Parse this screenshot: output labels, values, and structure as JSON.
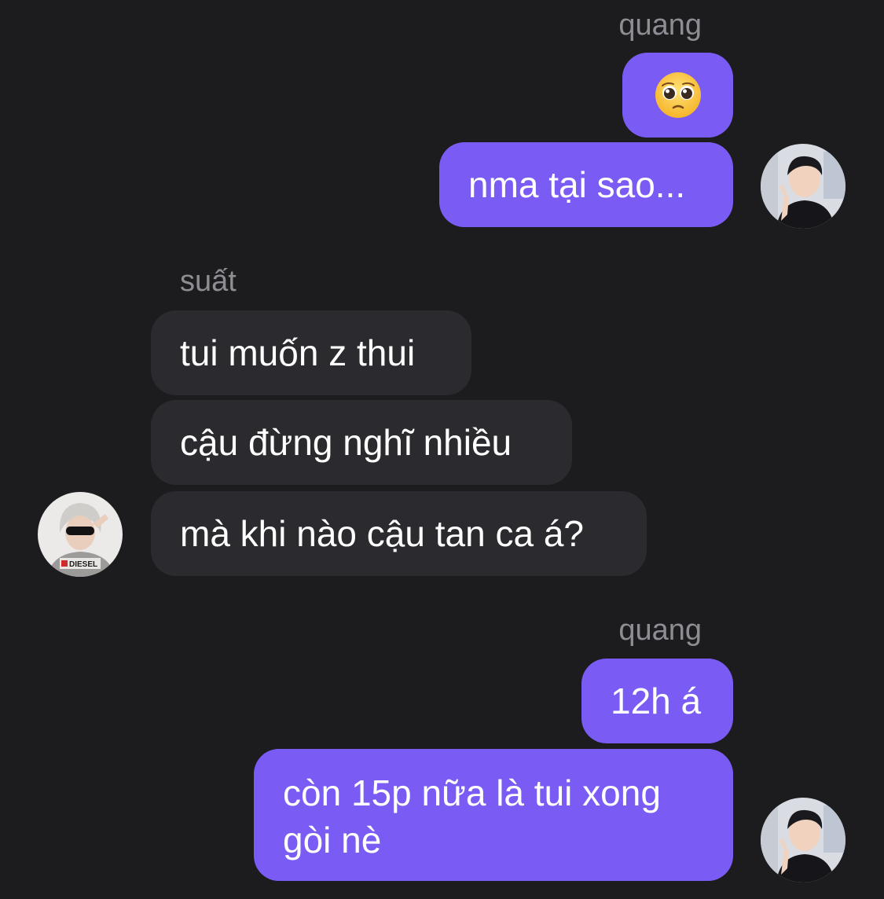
{
  "messages": [
    {
      "sender": "quang",
      "bubbles": [
        "🥺",
        "nma tại sao..."
      ]
    },
    {
      "sender": "suất",
      "bubbles": [
        "tui muốn z thui",
        "cậu đừng nghĩ nhiều",
        "mà khi nào cậu tan ca á?"
      ]
    },
    {
      "sender": "quang",
      "bubbles": [
        "12h á",
        "còn 15p nữa là tui xong gòi nè"
      ]
    }
  ],
  "avatars": {
    "quang": "avatar-quang",
    "suat": "avatar-suat"
  },
  "colors": {
    "background": "#1c1b1e",
    "outgoing_bubble": "#7a5cf5",
    "incoming_bubble": "#2b2a2f",
    "sender_name": "#8e8d93",
    "text": "#ffffff"
  },
  "avatar_badge_text": "DIESEL"
}
